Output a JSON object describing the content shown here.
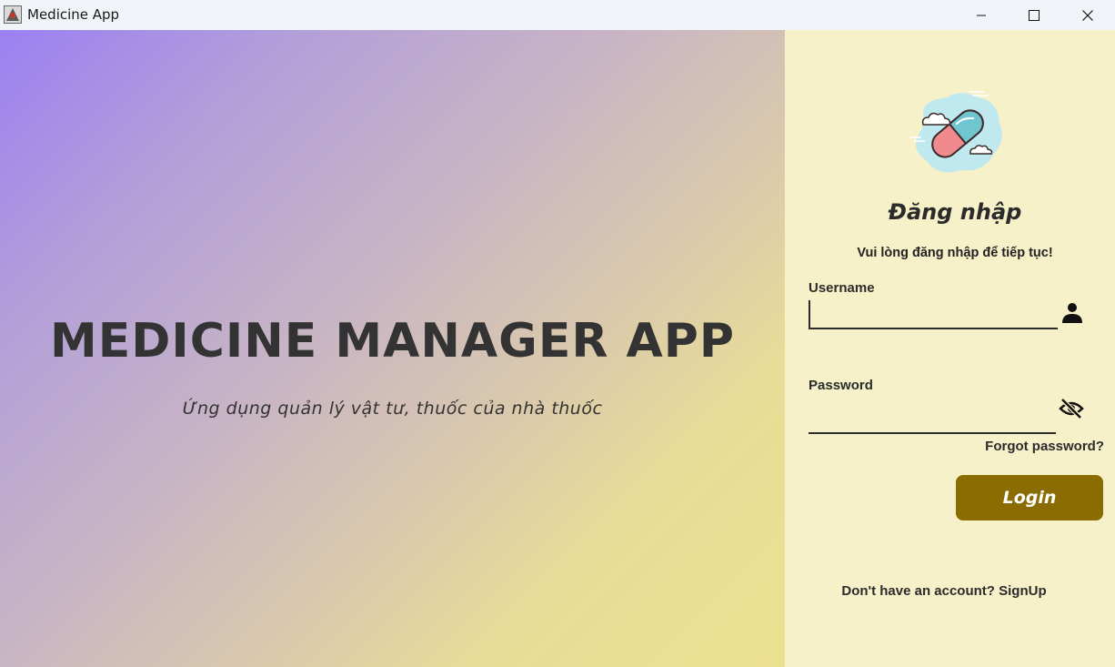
{
  "window": {
    "title": "Medicine App",
    "controls": [
      "minimize-icon",
      "maximize-icon",
      "close-icon"
    ]
  },
  "hero": {
    "title": "MEDICINE MANAGER APP",
    "subtitle": "Ứng dụng quản lý vật tư, thuốc của nhà thuốc"
  },
  "login": {
    "logo_icon": "pill-capsule-icon",
    "title": "Đăng nhập",
    "subtitle": "Vui lòng đăng nhập để tiếp tục!",
    "username_label": "Username",
    "username_value": "",
    "username_icon": "user-icon",
    "password_label": "Password",
    "password_value": "",
    "password_icon": "eye-off-icon",
    "forgot_label": "Forgot password?",
    "login_button": "Login",
    "signup_prompt": "Don't have an account?",
    "signup_link": "SignUp"
  },
  "colors": {
    "accent_button": "#8a6c03",
    "panel_bg": "#f7f1c9",
    "gradient_start": "#9b80f2",
    "gradient_end": "#ece190",
    "text_dark": "#333333"
  }
}
